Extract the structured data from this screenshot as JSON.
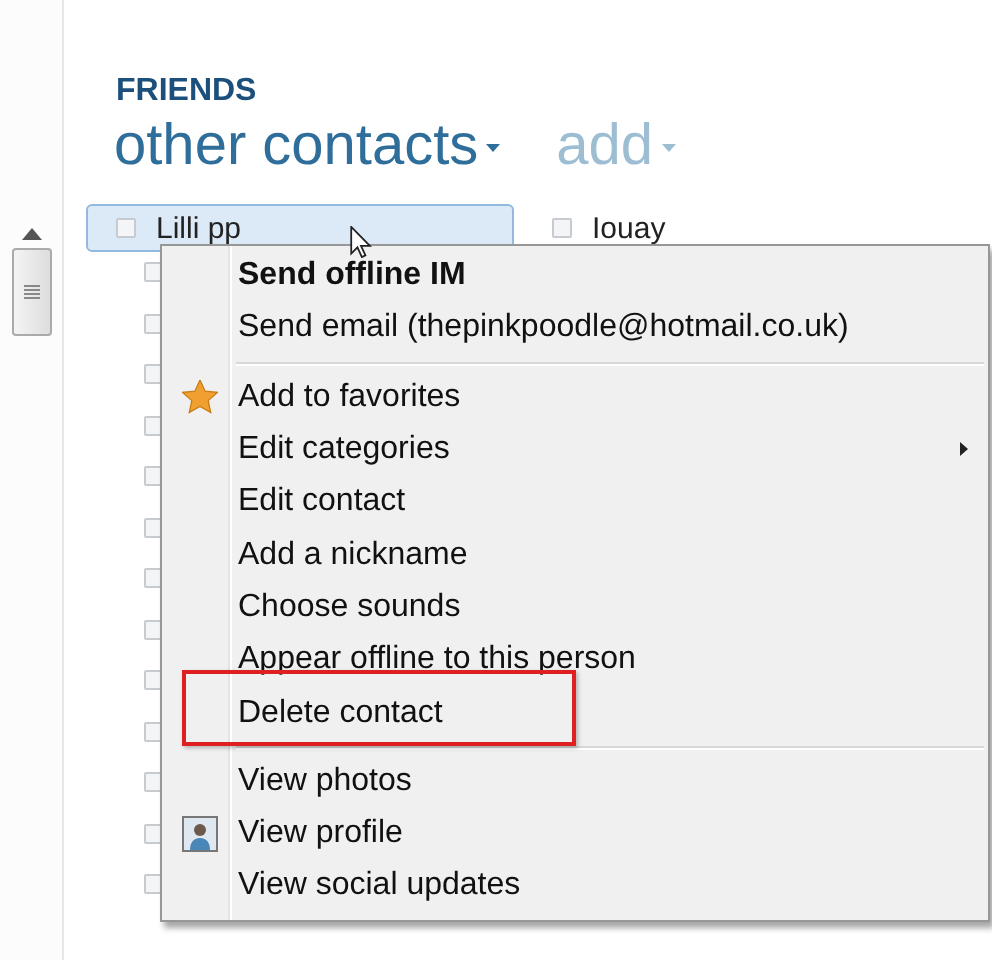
{
  "header": {
    "category": "FRIENDS",
    "view": "other contacts",
    "add": "add"
  },
  "contacts": [
    {
      "name": "Lilli pp",
      "selected": true
    },
    {
      "name": "Iouay",
      "selected": false
    }
  ],
  "context_menu": {
    "sections": [
      [
        {
          "label": "Send offline IM",
          "bold": true
        },
        {
          "label": "Send email (thepinkpoodle@hotmail.co.uk)",
          "bold": false
        }
      ],
      [
        {
          "label": "Add to favorites",
          "kind": "starred"
        },
        {
          "label": "Edit categories",
          "submenu": true
        },
        {
          "label": "Edit contact"
        },
        {
          "label": "Add a nickname"
        },
        {
          "label": "Choose sounds"
        },
        {
          "label": "Appear offline to this person"
        },
        {
          "label": "Delete contact",
          "annotated": true
        }
      ],
      [
        {
          "label": "View photos"
        },
        {
          "label": "View profile",
          "kind": "profile"
        },
        {
          "label": "View social updates"
        }
      ]
    ]
  }
}
